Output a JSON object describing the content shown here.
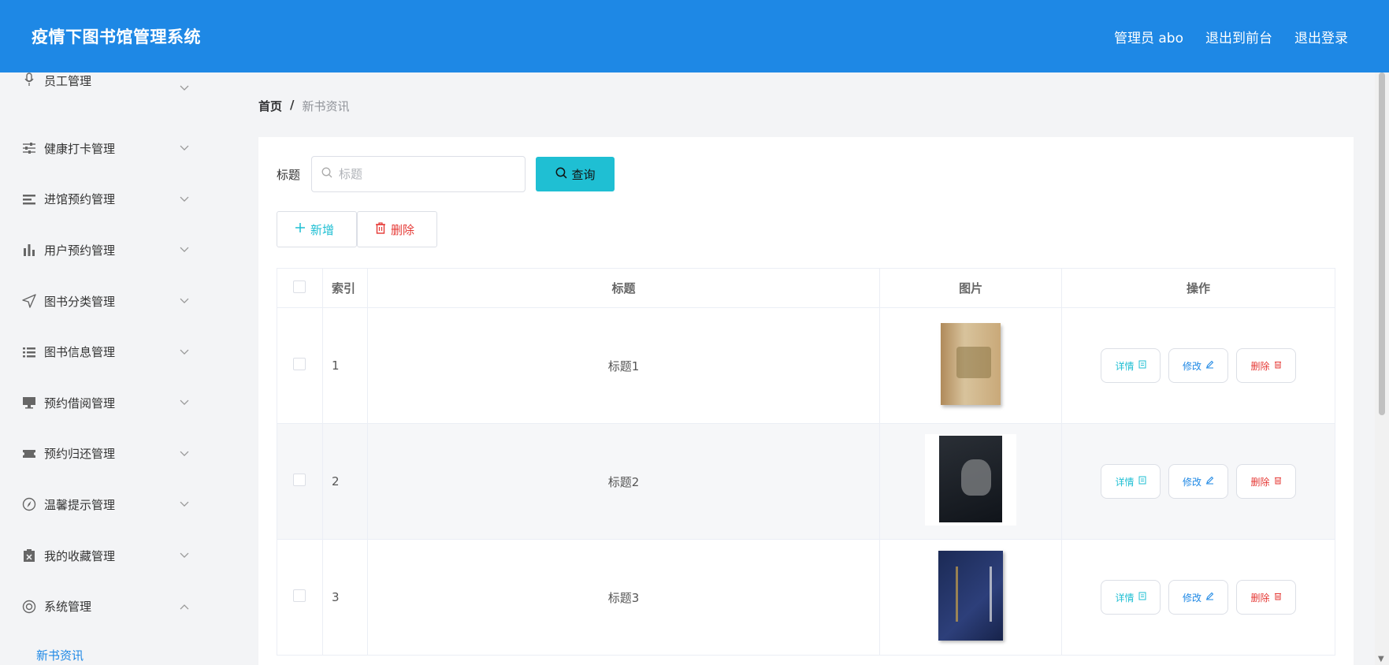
{
  "header": {
    "title": "疫情下图书馆管理系统",
    "user": "管理员 abo",
    "to_front": "退出到前台",
    "logout": "退出登录"
  },
  "sidebar": {
    "items": [
      {
        "label": "员工管理",
        "icon": "microphone-icon",
        "expanded": false
      },
      {
        "label": "健康打卡管理",
        "icon": "sliders-icon",
        "expanded": false
      },
      {
        "label": "进馆预约管理",
        "icon": "list-icon",
        "expanded": false
      },
      {
        "label": "用户预约管理",
        "icon": "bar-chart-icon",
        "expanded": false
      },
      {
        "label": "图书分类管理",
        "icon": "send-icon",
        "expanded": false
      },
      {
        "label": "图书信息管理",
        "icon": "list-ordered-icon",
        "expanded": false
      },
      {
        "label": "预约借阅管理",
        "icon": "monitor-icon",
        "expanded": false
      },
      {
        "label": "预约归还管理",
        "icon": "ticket-icon",
        "expanded": false
      },
      {
        "label": "温馨提示管理",
        "icon": "compass-icon",
        "expanded": false
      },
      {
        "label": "我的收藏管理",
        "icon": "clipboard-icon",
        "expanded": false
      },
      {
        "label": "系统管理",
        "icon": "lifebuoy-icon",
        "expanded": true
      }
    ],
    "subitem": "新书资讯"
  },
  "breadcrumb": {
    "home": "首页",
    "separator": "/",
    "current": "新书资讯"
  },
  "search": {
    "label": "标题",
    "placeholder": "标题",
    "button": "查询"
  },
  "actions": {
    "add": "新增",
    "delete": "删除"
  },
  "table": {
    "headers": {
      "index": "索引",
      "title": "标题",
      "image": "图片",
      "ops": "操作"
    },
    "rows": [
      {
        "index": "1",
        "title": "标题1"
      },
      {
        "index": "2",
        "title": "标题2"
      },
      {
        "index": "3",
        "title": "标题3"
      }
    ],
    "op_labels": {
      "detail": "详情",
      "edit": "修改",
      "delete": "删除"
    }
  },
  "colors": {
    "primary": "#1e88e5",
    "accent": "#1fbfd3",
    "danger": "#e53935"
  }
}
